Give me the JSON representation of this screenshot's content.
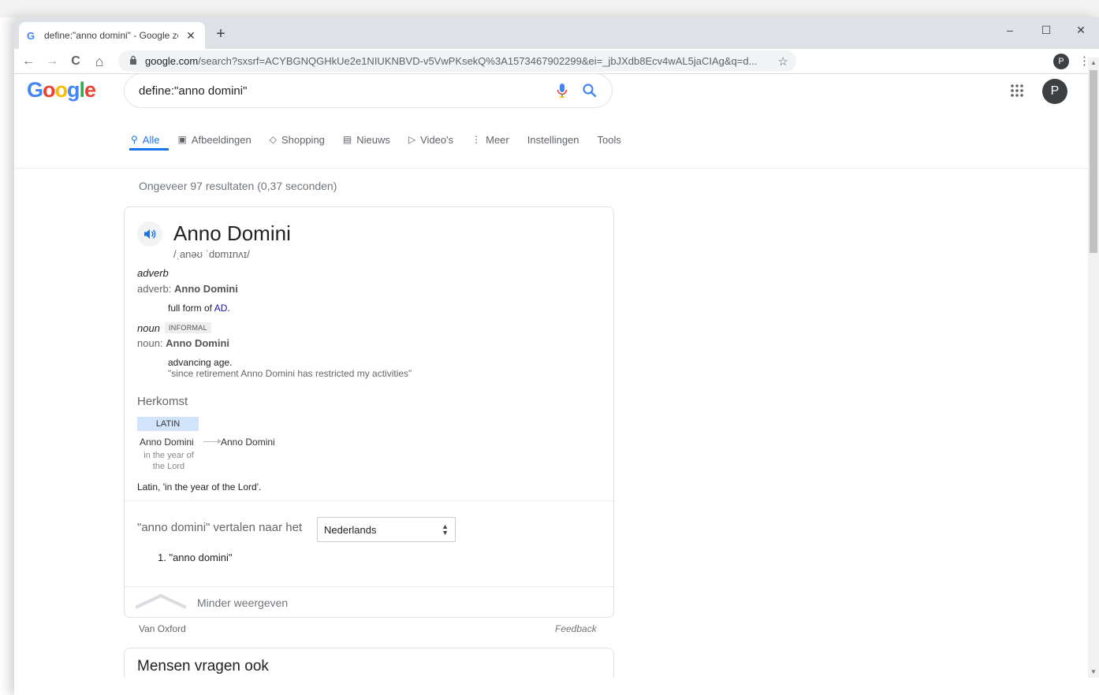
{
  "browser": {
    "tab_title": "define:\"anno domini\" - Google zo",
    "tab_favicon": "G",
    "new_tab": "+",
    "url_domain": "google.com",
    "url_rest": "/search?sxsrf=ACYBGNQGHkUe2e1NIUKNBVD-v5VwPKsekQ%3A1573467902299&ei=_jbJXdb8Ecv4wAL5jaCIAg&q=d...",
    "profile_initial": "P",
    "icons": {
      "minimize": "–",
      "maximize": "☐",
      "close": "✕",
      "back": "←",
      "forward": "→",
      "reload": "C",
      "home": "⌂",
      "lock": "🔒",
      "star": "☆",
      "menu": "⋮",
      "tab_close": "✕"
    }
  },
  "header": {
    "logo_letters": [
      {
        "ch": "G",
        "color": "#4285F4"
      },
      {
        "ch": "o",
        "color": "#EA4335"
      },
      {
        "ch": "o",
        "color": "#FBBC05"
      },
      {
        "ch": "g",
        "color": "#4285F4"
      },
      {
        "ch": "l",
        "color": "#34A853"
      },
      {
        "ch": "e",
        "color": "#EA4335"
      }
    ],
    "query": "define:\"anno domini\"",
    "avatar_initial": "P"
  },
  "nav": {
    "tabs": [
      {
        "label": "Alle",
        "icon": "⚲"
      },
      {
        "label": "Afbeeldingen",
        "icon": "▣"
      },
      {
        "label": "Shopping",
        "icon": "◇"
      },
      {
        "label": "Nieuws",
        "icon": "▤"
      },
      {
        "label": "Video's",
        "icon": "▷"
      },
      {
        "label": "Meer",
        "icon": "⋮"
      },
      {
        "label": "Instellingen",
        "icon": ""
      },
      {
        "label": "Tools",
        "icon": ""
      }
    ]
  },
  "results": {
    "stats": "Ongeveer 97 resultaten (0,37 seconden)"
  },
  "dictionary": {
    "headword": "Anno Domini",
    "phonetic": "/ˌanəʊ ˈdɒmɪnʌɪ/",
    "sense1_pos": "adverb",
    "sense1_line_prefix": "adverb: ",
    "sense1_line_word": "Anno Domini",
    "sense1_def_prefix": "full form of ",
    "sense1_def_link": "AD",
    "sense1_def_suffix": ".",
    "sense2_pos": "noun",
    "sense2_badge": "INFORMAL",
    "sense2_line_prefix": "noun: ",
    "sense2_line_word": "Anno Domini",
    "sense2_def": "advancing age.",
    "sense2_example": "\"since retirement Anno Domini has restricted my activities\"",
    "origin_heading": "Herkomst",
    "origin_lang": "LATIN",
    "origin_from": "Anno Domini",
    "origin_to": "Anno Domini",
    "origin_gloss_line1": "in the year of",
    "origin_gloss_line2": "the Lord",
    "origin_text": "Latin, 'in the year of the Lord'.",
    "translate_label": "\"anno domini\" vertalen naar het",
    "translate_language": "Nederlands",
    "translation_1": "1. \"anno domini\"",
    "show_less": "Minder weergeven"
  },
  "footer": {
    "source": "Van Oxford",
    "feedback": "Feedback"
  },
  "people_also_ask": {
    "title": "Mensen vragen ook"
  }
}
